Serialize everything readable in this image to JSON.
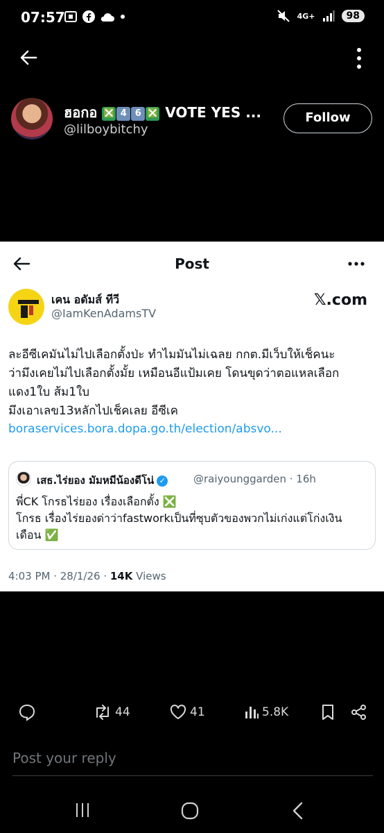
{
  "status_bar": {
    "time": "07:57",
    "network": "4G+",
    "battery": "98"
  },
  "profile": {
    "name_text": "ฮอกอ",
    "name_emoji": [
      "❎",
      "4",
      "6",
      "❎"
    ],
    "name_suffix": "VOTE YES ...",
    "handle": "@lilboybitchy",
    "follow_label": "Follow"
  },
  "post": {
    "header_title": "Post",
    "author_name": "เคน อดัมส์ ทีวี",
    "author_handle": "@IamKenAdamsTV",
    "source": "𝕏.com",
    "text_lines": [
      "ละอีซีเคมันไม่ไปเลือกตั้งป่ะ ทำไมมันไม่เฉลย กกต.มีเว็บให้เช็คนะ",
      "ว่ามึงเคยไม่ไปเลือกตั้งมั้ย เหมือนอีแป้มเคย โดนขุดว่าตอแหลเลือก",
      "แดง1ใบ ส้ม1ใบ",
      "มึงเอาเลข13หลักไปเช็คเลย อีซีเค"
    ],
    "link": "boraservices.bora.dopa.go.th/election/absvo...",
    "quote": {
      "name": "เสธ.ไร่ยอง มัมหมีน้องดีโน่",
      "handle_time": "@raiyounggarden · 16h",
      "lines": [
        "พี่CK โกรธไร่ยอง เรื่องเลือกตั้ง ❎",
        "โกรธ เรื่องไร่ยองด่าว่าfastworkเป็นที่ซุบตัวของพวกไม่เก่งแต่โก่งเงิน",
        "เดือน ✅"
      ]
    },
    "timestamp": "4:03 PM · 28/1/26 · ",
    "views_count": "14K",
    "views_label": " Views"
  },
  "actions": {
    "retweets": "44",
    "likes": "41",
    "views": "5.8K"
  },
  "reply": {
    "placeholder": "Post your reply"
  },
  "colors": {
    "link": "#1d9bf0",
    "verified": "#1d9bf0",
    "emoji_x": "#2e9a55"
  }
}
